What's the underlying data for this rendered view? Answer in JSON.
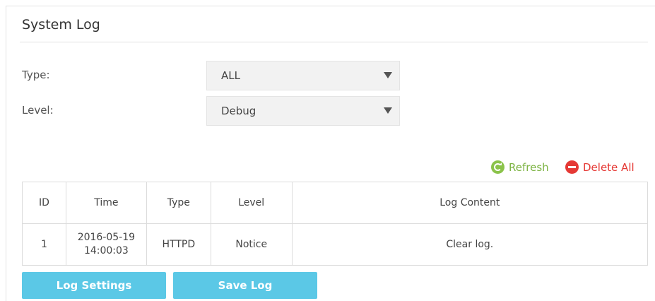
{
  "page": {
    "title": "System Log"
  },
  "filters": {
    "type_label": "Type:",
    "type_value": "ALL",
    "level_label": "Level:",
    "level_value": "Debug"
  },
  "actions": {
    "refresh": "Refresh",
    "delete_all": "Delete All"
  },
  "table": {
    "headers": [
      "ID",
      "Time",
      "Type",
      "Level",
      "Log Content"
    ],
    "rows": [
      {
        "id": "1",
        "time_date": "2016-05-19",
        "time_clock": "14:00:03",
        "type": "HTTPD",
        "level": "Notice",
        "content": "Clear log."
      }
    ]
  },
  "buttons": {
    "log_settings": "Log Settings",
    "save_log": "Save Log"
  },
  "colors": {
    "accent_button": "#5bc8e6",
    "refresh": "#8bc34a",
    "delete": "#e53935"
  },
  "icons": {
    "type_dropdown": "caret-down-icon",
    "level_dropdown": "caret-down-icon",
    "refresh": "refresh-icon",
    "delete": "minus-circle-icon"
  }
}
